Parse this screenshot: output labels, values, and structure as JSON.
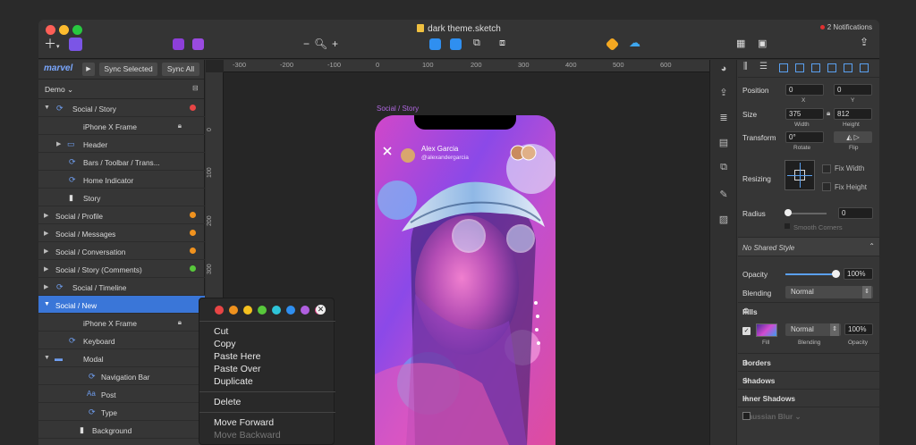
{
  "window": {
    "title": "dark theme.sketch",
    "notifications": "2 Notifications"
  },
  "toolbar": {
    "zoom_minus": "−",
    "zoom_plus": "+"
  },
  "plugin": {
    "logo": "marvel",
    "sync_selected": "Sync Selected",
    "sync_all": "Sync All"
  },
  "pages": {
    "current": "Demo ⌄"
  },
  "layers": [
    {
      "label": "Social / Story",
      "status": "#e84545",
      "expanded": true
    },
    {
      "label": "iPhone X Frame",
      "locked": true
    },
    {
      "label": "Header"
    },
    {
      "label": "Bars / Toolbar / Trans..."
    },
    {
      "label": "Home Indicator"
    },
    {
      "label": "Story"
    },
    {
      "label": "Social / Profile",
      "status": "#f0921e"
    },
    {
      "label": "Social / Messages",
      "status": "#f0921e"
    },
    {
      "label": "Social / Conversation",
      "status": "#f0921e"
    },
    {
      "label": "Social / Story (Comments)",
      "status": "#58c83b"
    },
    {
      "label": "Social / Timeline"
    },
    {
      "label": "Social / New",
      "selected": true
    },
    {
      "label": "iPhone X Frame",
      "locked": true
    },
    {
      "label": "Keyboard"
    },
    {
      "label": "Modal"
    },
    {
      "label": "Navigation Bar"
    },
    {
      "label": "Post"
    },
    {
      "label": "Type"
    },
    {
      "label": "Background"
    }
  ],
  "ruler": {
    "h_ticks": [
      "-300",
      "-200",
      "-100",
      "0",
      "100",
      "200",
      "300",
      "400",
      "500",
      "600"
    ],
    "v_ticks": [
      "0",
      "100",
      "200",
      "300"
    ]
  },
  "artboard": {
    "label": "Social / Story",
    "user_name": "Alex Garcia",
    "user_handle": "@alexandergarcia"
  },
  "context_menu": {
    "colors": [
      "#e84545",
      "#f0921e",
      "#f5c11f",
      "#58c83b",
      "#2ec4d8",
      "#2f8ff0",
      "#b05fe0",
      "#e8408a"
    ],
    "items": [
      "Cut",
      "Copy",
      "Paste Here",
      "Paste Over",
      "Duplicate",
      "Delete",
      "Move Forward",
      "Move Backward"
    ]
  },
  "inspector": {
    "position_label": "Position",
    "x": "0",
    "y": "0",
    "x_label": "X",
    "y_label": "Y",
    "size_label": "Size",
    "width": "375",
    "height": "812",
    "width_label": "Width",
    "height_label": "Height",
    "transform_label": "Transform",
    "rotate": "0°",
    "rotate_label": "Rotate",
    "flip_label": "Flip",
    "resizing_label": "Resizing",
    "fix_width": "Fix Width",
    "fix_height": "Fix Height",
    "radius_label": "Radius",
    "radius": "0",
    "smooth_corners": "Smooth Corners",
    "shared_style": "No Shared Style",
    "opacity_label": "Opacity",
    "opacity": "100%",
    "opacity_level": 1.0,
    "blending_label": "Blending",
    "blending": "Normal",
    "fills_label": "Fills",
    "fill_blending": "Normal",
    "fill_opacity": "100%",
    "fill_sub": "Fill",
    "fill_blend_sub": "Blending",
    "fill_opacity_sub": "Opacity",
    "borders_label": "Borders",
    "shadows_label": "Shadows",
    "inner_shadows_label": "Inner Shadows",
    "gaussian_blur_label": "Gaussian Blur ⌄"
  }
}
